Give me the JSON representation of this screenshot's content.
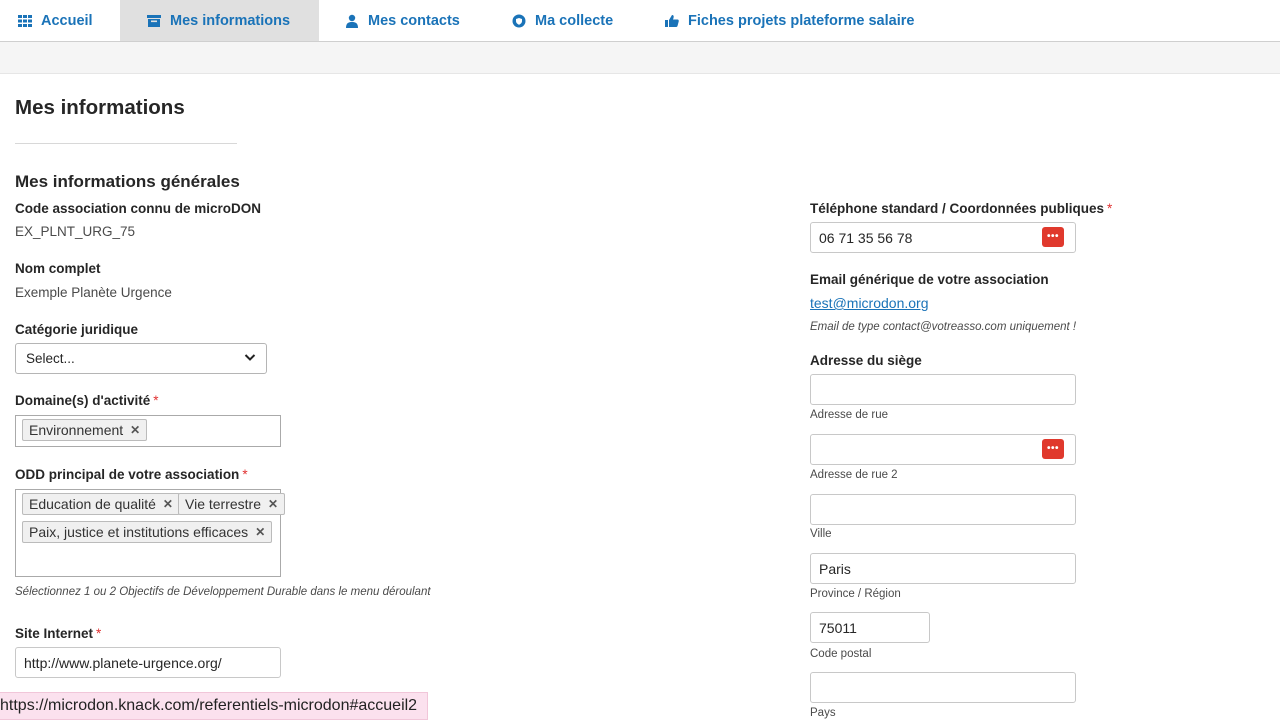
{
  "nav": {
    "tabs": [
      {
        "label": "Accueil",
        "icon": "grid-icon",
        "active": false
      },
      {
        "label": "Mes informations",
        "icon": "id-card-icon",
        "active": true
      },
      {
        "label": "Mes contacts",
        "icon": "user-icon",
        "active": false
      },
      {
        "label": "Ma collecte",
        "icon": "shield-icon",
        "active": false
      },
      {
        "label": "Fiches projets plateforme salaire",
        "icon": "thumbs-up-icon",
        "active": false
      }
    ]
  },
  "page": {
    "title": "Mes informations",
    "section_title": "Mes informations générales"
  },
  "left": {
    "code_label": "Code association connu de microDON",
    "code_value": "EX_PLNT_URG_75",
    "nom_label": "Nom complet",
    "nom_value": "Exemple Planète Urgence",
    "categorie_label": "Catégorie juridique",
    "categorie_selected": "Select...",
    "domaines_label": "Domaine(s) d'activité",
    "domaines_tags": [
      "Environnement"
    ],
    "odd_label": "ODD principal de votre association",
    "odd_tags": [
      "Education de qualité",
      "Vie terrestre",
      "Paix, justice et institutions efficaces"
    ],
    "odd_hint": "Sélectionnez 1 ou 2 Objectifs de Développement Durable dans le menu déroulant",
    "site_label": "Site Internet",
    "site_value": "http://www.planete-urgence.org/",
    "required_mark": "*"
  },
  "right": {
    "tel_label": "Téléphone standard / Coordonnées publiques",
    "tel_value": "06 71 35 56 78",
    "email_label": "Email générique de votre association",
    "email_value": "test@microdon.org",
    "email_hint": "Email de type contact@votreasso.com uniquement !",
    "adresse_label": "Adresse du siège",
    "rue_value": "",
    "rue_label": "Adresse de rue",
    "rue2_value": "",
    "rue2_label": "Adresse de rue 2",
    "ville_value": "",
    "ville_label": "Ville",
    "region_value": "Paris",
    "region_label": "Province / Région",
    "cp_value": "75011",
    "cp_label": "Code postal",
    "pays_value": "",
    "pays_label": "Pays"
  },
  "statusbar": {
    "url": "https://microdon.knack.com/referentiels-microdon#accueil2"
  },
  "colors": {
    "accent": "#1a73b8",
    "required": "#e03131",
    "password_icon": "#e0392d",
    "active_tab_bg": "#e0e0e0"
  }
}
